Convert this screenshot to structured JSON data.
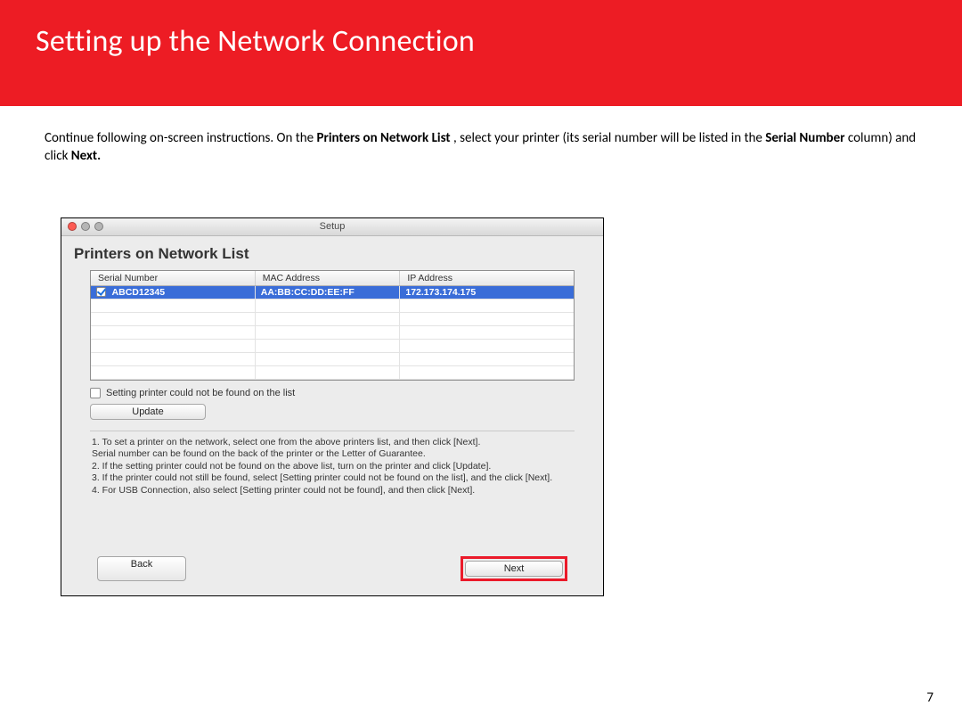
{
  "banner": {
    "title": "Setting up the Network Connection"
  },
  "body": {
    "p1a": "Continue following on-screen instructions.  On the ",
    "b1": "Printers on Network List",
    "p1b": ", select your printer (its serial number will be listed in the ",
    "b2": "Serial Number",
    "p1c": " column) and click ",
    "b3": "Next.",
    "p1d": ""
  },
  "window": {
    "title": "Setup",
    "heading": "Printers on Network List",
    "columns": {
      "serial": "Serial Number",
      "mac": "MAC Address",
      "ip": "IP Address"
    },
    "row": {
      "serial": "ABCD12345",
      "mac": "AA:BB:CC:DD:EE:FF",
      "ip": "172.173.174.175"
    },
    "notfound_label": "Setting printer could not be found on the list",
    "update_btn": "Update",
    "instructions": "1. To set a printer on the network, select one from the above printers list, and then click [Next].\nSerial number can be found on the back of the printer or the Letter of Guarantee.\n2. If the setting printer could not be found on the above list, turn on the printer and click [Update].\n3. If the printer could not still be found, select [Setting printer could not be found on the list], and the click [Next].\n4. For USB Connection, also select [Setting printer could not be found], and then click [Next].",
    "back_btn": "Back",
    "next_btn": "Next"
  },
  "page_number": "7"
}
